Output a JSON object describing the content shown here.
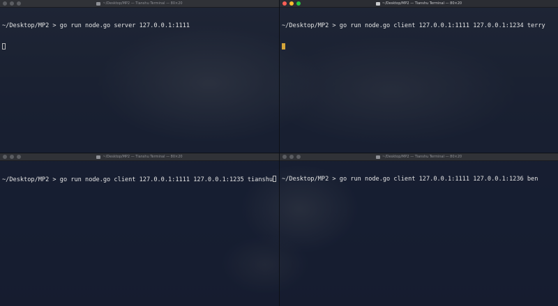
{
  "windows": {
    "top_left": {
      "title": "~/Desktop/MP2 — Tianshu Terminal — 80×20",
      "prompt": "~/Desktop/MP2 > ",
      "command": "go run node.go server 127.0.0.1:1111"
    },
    "top_right": {
      "title": "~/Desktop/MP2 — Tianshu Terminal — 80×20",
      "prompt": "~/Desktop/MP2 > ",
      "command": "go run node.go client 127.0.0.1:1111 127.0.0.1:1234 terry"
    },
    "bottom_left": {
      "title": "~/Desktop/MP2 — Tianshu Terminal — 80×20",
      "prompt": "~/Desktop/MP2 > ",
      "command": "go run node.go client 127.0.0.1:1111 127.0.0.1:1235 tianshu"
    },
    "bottom_right": {
      "title": "~/Desktop/MP2 — Tianshu Terminal — 80×20",
      "prompt": "~/Desktop/MP2 > ",
      "command_part1": "go run node.go client 127.0.0.1:1111 ",
      "command_part2": "127.0.0.1:1236 ben"
    }
  },
  "colors": {
    "cursor_active": "#d4a53a",
    "close": "#fe5f57",
    "minimize": "#febc2e",
    "zoom": "#28c840"
  }
}
